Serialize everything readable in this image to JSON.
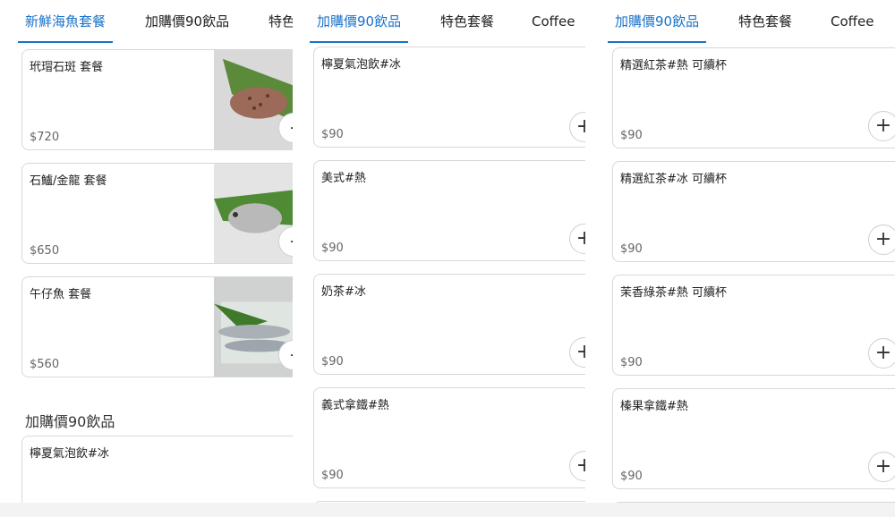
{
  "panel1": {
    "tabs": [
      "新鮮海魚套餐",
      "加購價90飲品",
      "特色"
    ],
    "items": [
      {
        "name": "玳瑁石斑 套餐",
        "price": "$720"
      },
      {
        "name": "石鱸/金龍 套餐",
        "price": "$650"
      },
      {
        "name": "午仔魚 套餐",
        "price": "$560"
      }
    ],
    "section_title": "加購價90飲品",
    "partial_item": {
      "name": "檸夏氣泡飲#冰"
    }
  },
  "panel2": {
    "tabs": [
      "加購價90飲品",
      "特色套餐",
      "Coffee"
    ],
    "items": [
      {
        "name": "檸夏氣泡飲#冰",
        "price": "$90"
      },
      {
        "name": "美式#熱",
        "price": "$90"
      },
      {
        "name": "奶茶#冰",
        "price": "$90"
      },
      {
        "name": "義式拿鐵#熱",
        "price": "$90"
      }
    ]
  },
  "panel3": {
    "tabs": [
      "加購價90飲品",
      "特色套餐",
      "Coffee"
    ],
    "items": [
      {
        "name": "精選紅茶#熱 可續杯",
        "price": "$90"
      },
      {
        "name": "精選紅茶#冰 可續杯",
        "price": "$90"
      },
      {
        "name": "茉香綠茶#熱 可續杯",
        "price": "$90"
      },
      {
        "name": "榛果拿鐵#熱",
        "price": "$90"
      }
    ]
  },
  "icons": {
    "add": "+",
    "remove": "-"
  },
  "colors": {
    "accent": "#1a73c9",
    "border": "#d8d8d8",
    "price": "#666666"
  }
}
